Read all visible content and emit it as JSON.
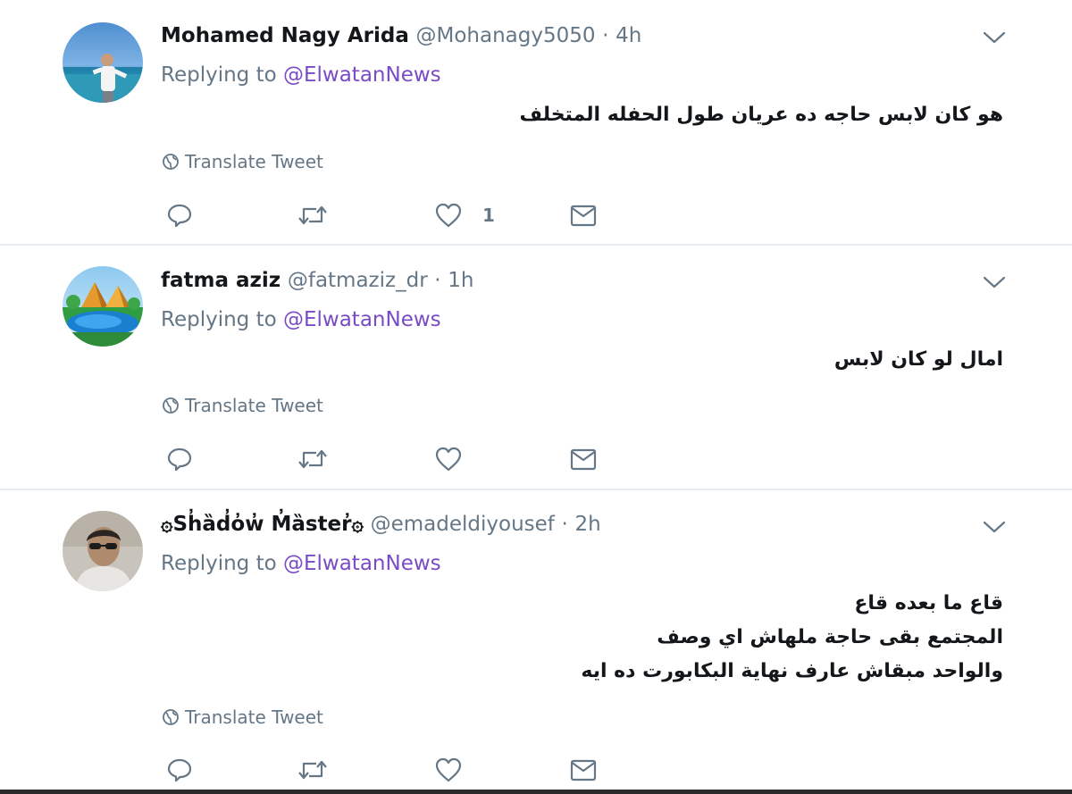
{
  "tweets": [
    {
      "display_name": "Mohamed Nagy Arida",
      "handle": "@Mohanagy5050",
      "separator": "·",
      "time": "4h",
      "replying_prefix": "Replying to ",
      "replying_to": "@ElwatanNews",
      "text_lines": [
        "هو كان لابس حاجه ده عريان طول الحفله المتخلف"
      ],
      "translate_label": "Translate Tweet",
      "like_count": "1"
    },
    {
      "display_name": "fatma aziz",
      "handle": "@fatmaziz_dr",
      "separator": "·",
      "time": "1h",
      "replying_prefix": "Replying to ",
      "replying_to": "@ElwatanNews",
      "text_lines": [
        "امال لو كان لابس"
      ],
      "translate_label": "Translate Tweet",
      "like_count": ""
    },
    {
      "display_name": "۞Sh̓ȁd̓o̓w̓ M̓ȁster̓۞",
      "handle": "@emadeldiyousef",
      "separator": "·",
      "time": "2h",
      "replying_prefix": "Replying to ",
      "replying_to": "@ElwatanNews",
      "text_lines": [
        "قاع ما بعده قاع",
        "المجتمع بقى حاجة ملهاش اي وصف",
        "والواحد مبقاش عارف نهاية البكابورت ده ايه"
      ],
      "translate_label": "Translate Tweet",
      "like_count": ""
    }
  ],
  "colors": {
    "text_primary": "#14171a",
    "text_secondary": "#657786",
    "link": "#794bc4",
    "divider": "#e6ecf0"
  },
  "icons": {
    "reply": "reply-icon",
    "retweet": "retweet-icon",
    "like": "heart-icon",
    "dm": "envelope-icon",
    "translate": "globe-icon",
    "menu": "chevron-down-icon"
  }
}
